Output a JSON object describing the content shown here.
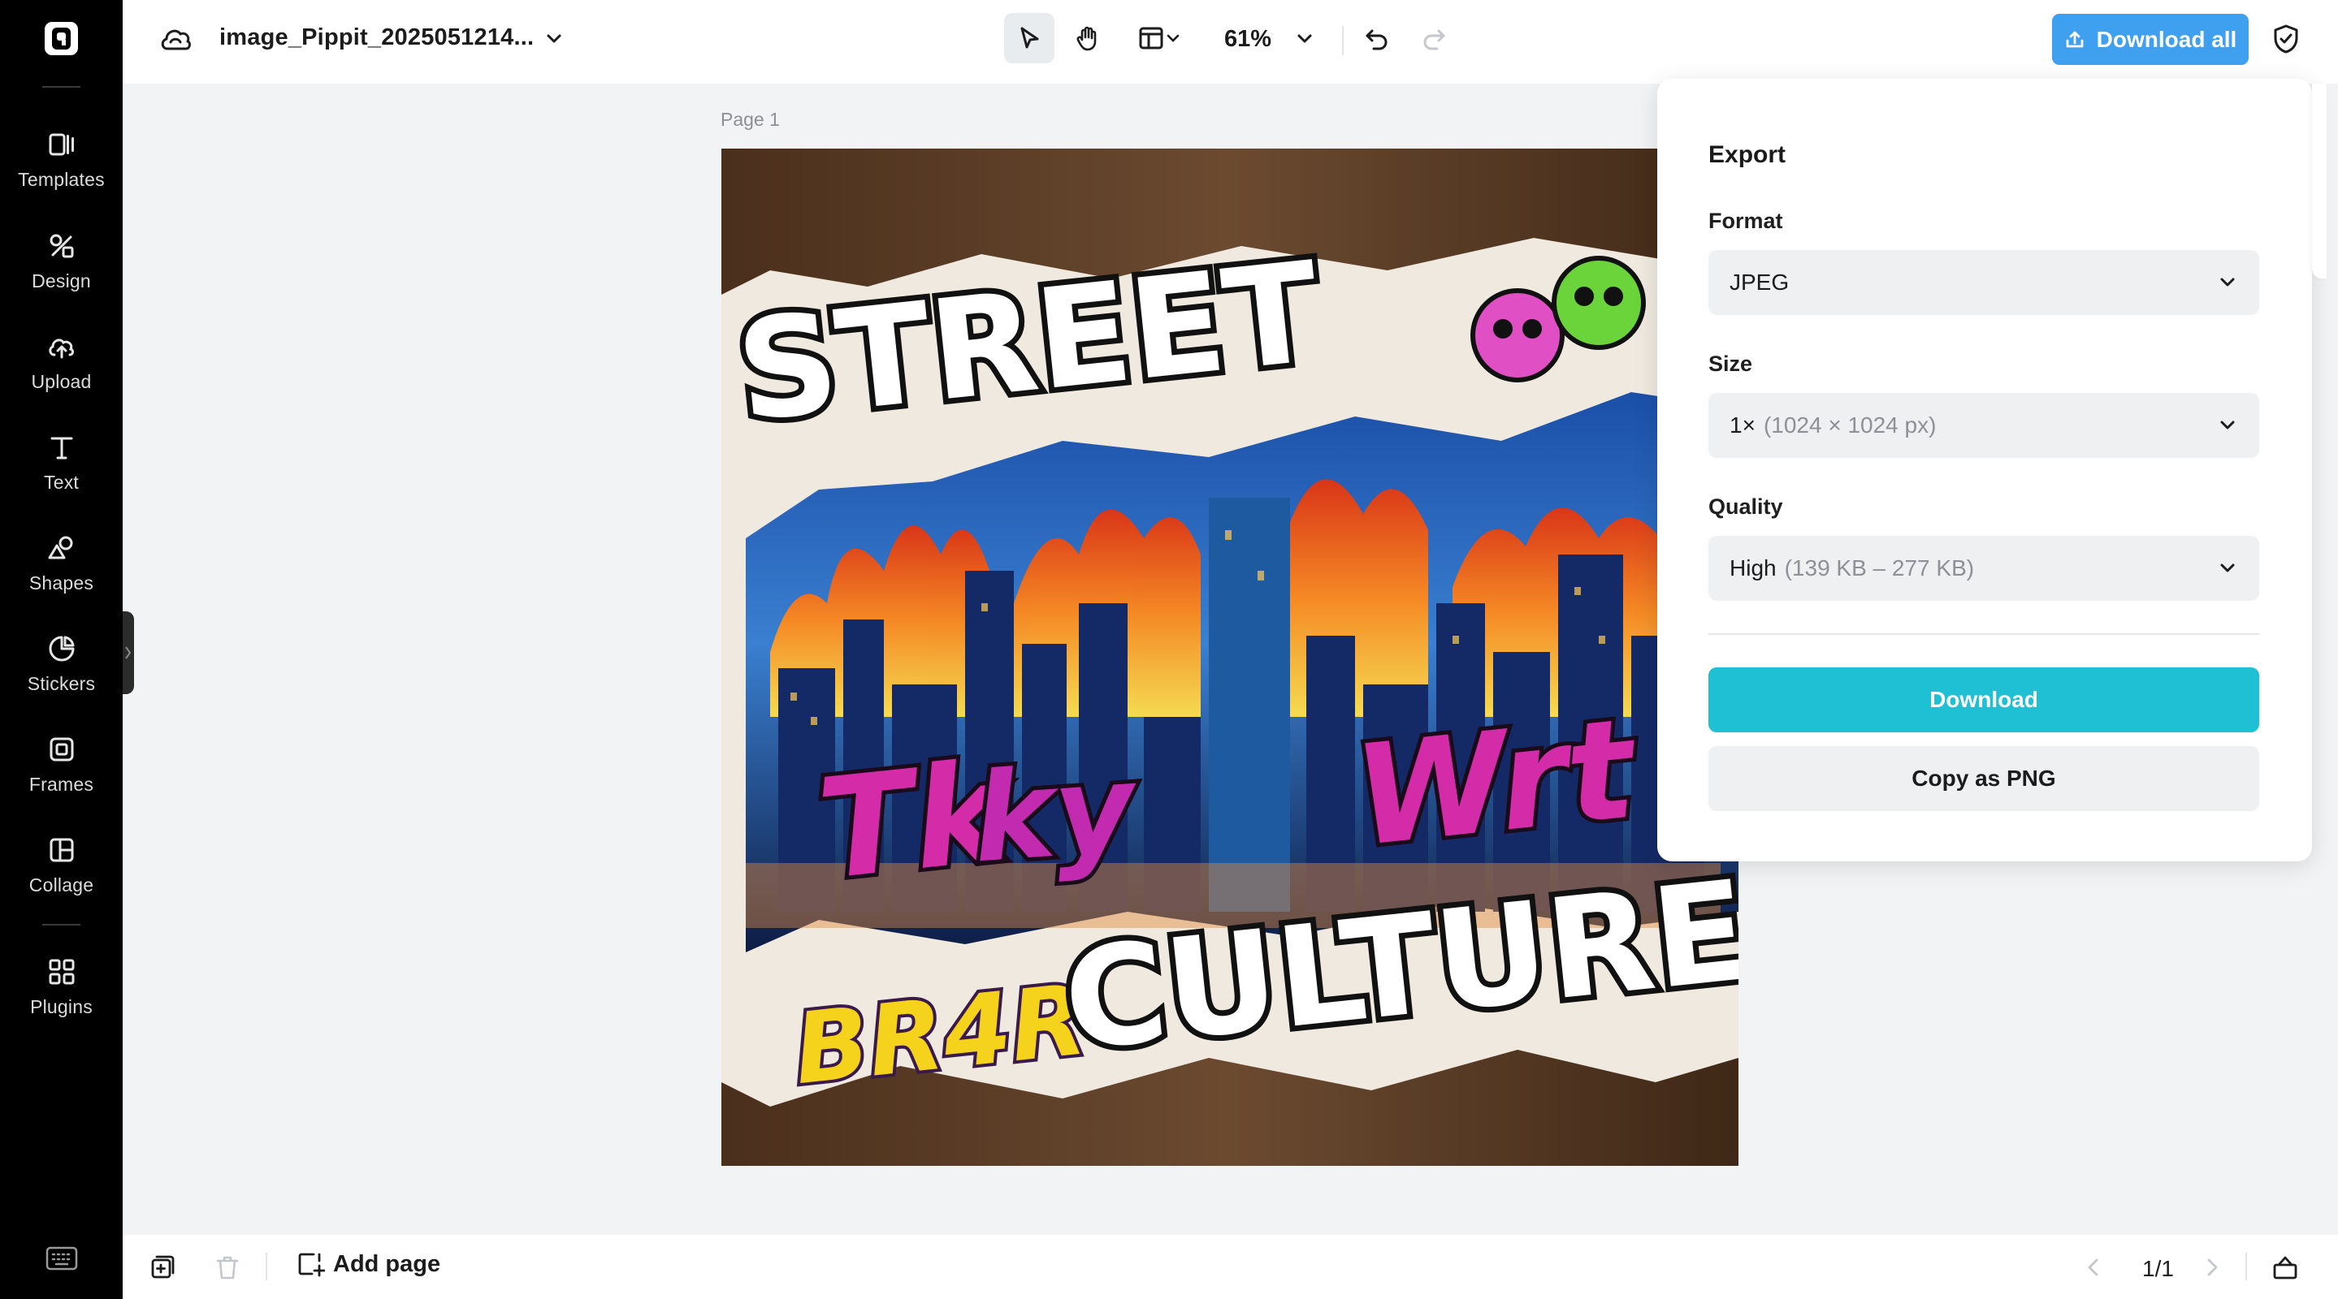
{
  "app": {
    "brand_colors": {
      "accent_blue": "#3fa0f0",
      "download_cyan": "#1fc0d4",
      "sidebar_bg": "#000000"
    }
  },
  "sidebar": {
    "items": [
      {
        "label": "Templates",
        "icon": "templates-icon"
      },
      {
        "label": "Design",
        "icon": "design-icon"
      },
      {
        "label": "Upload",
        "icon": "upload-icon"
      },
      {
        "label": "Text",
        "icon": "text-icon"
      },
      {
        "label": "Shapes",
        "icon": "shapes-icon"
      },
      {
        "label": "Stickers",
        "icon": "stickers-icon"
      },
      {
        "label": "Frames",
        "icon": "frames-icon"
      },
      {
        "label": "Collage",
        "icon": "collage-icon"
      },
      {
        "label": "Plugins",
        "icon": "plugins-icon"
      }
    ]
  },
  "header": {
    "doc_title": "image_Pippit_2025051214...",
    "zoom": "61%",
    "download_all_label": "Download all"
  },
  "canvas": {
    "page_label": "Page 1",
    "image_text": {
      "top": "STREET",
      "bottom": "CULTURE"
    }
  },
  "export_panel": {
    "title": "Export",
    "format": {
      "label": "Format",
      "value": "JPEG"
    },
    "size": {
      "label": "Size",
      "value": "1×",
      "detail": "(1024 × 1024 px)"
    },
    "quality": {
      "label": "Quality",
      "value": "High",
      "detail": "(139 KB – 277 KB)"
    },
    "download_label": "Download",
    "copy_label": "Copy as PNG"
  },
  "footer": {
    "add_page_label": "Add page",
    "page_count": "1/1"
  }
}
